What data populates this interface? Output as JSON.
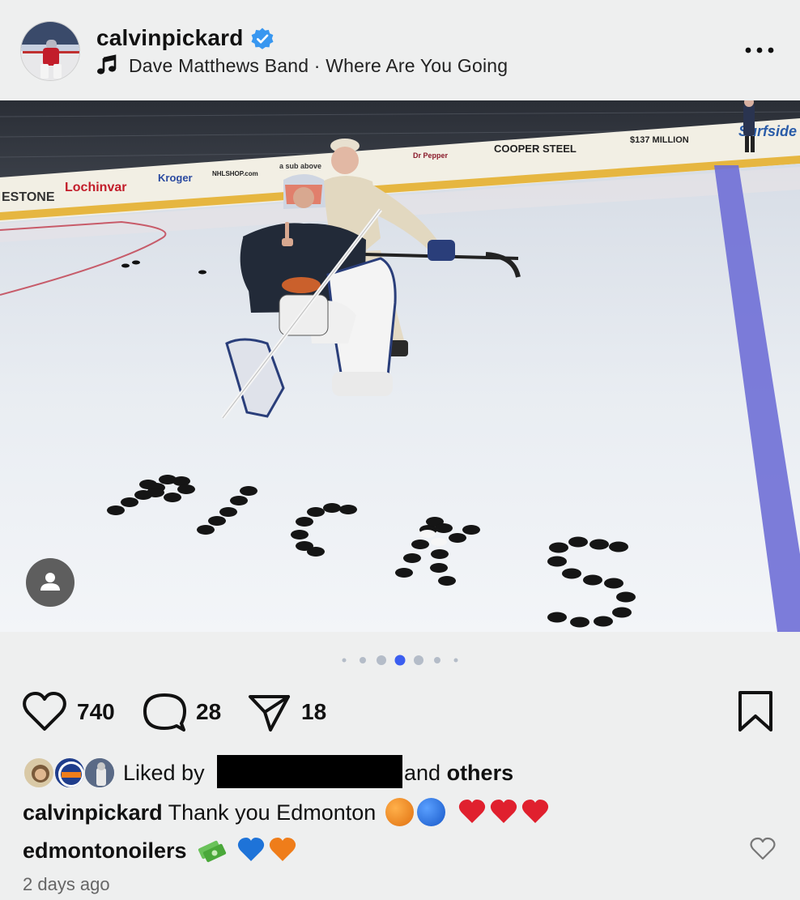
{
  "post": {
    "username": "calvinpickard",
    "music": "Dave Matthews Band · Where Are You Going",
    "likes": "740",
    "comments": "28",
    "shares": "18",
    "liked_by_label": "Liked by",
    "and_others_prefix": "and",
    "and_others_bold": "others",
    "caption_user": "calvinpickard",
    "caption_text": "Thank you Edmonton",
    "comment_user": "edmontonoilers",
    "timestamp": "2 days ago",
    "carousel": {
      "count": 7,
      "active": 3
    }
  },
  "photo_texts": {
    "arena_ads": [
      "ESTONE",
      "Lochinvar",
      "Kroger",
      "NHLSHOP.com",
      "a sub above",
      "Dr Pepper",
      "COOPER STEEL",
      "$137 MILLION",
      "Surfside"
    ]
  },
  "colors": {
    "accent_blue": "#3b5ef0",
    "verified_blue": "#3897f0",
    "oilers_orange": "#ef7d1a",
    "oilers_blue": "#1e73d8",
    "heart_red": "#e0202e"
  },
  "icons": {
    "verified": "verified-badge-icon",
    "music": "music-note-icon",
    "more": "more-options-icon",
    "tag": "user-tag-icon",
    "like": "heart-outline-icon",
    "comment": "comment-bubble-icon",
    "share": "send-paper-plane-icon",
    "save": "bookmark-icon"
  }
}
